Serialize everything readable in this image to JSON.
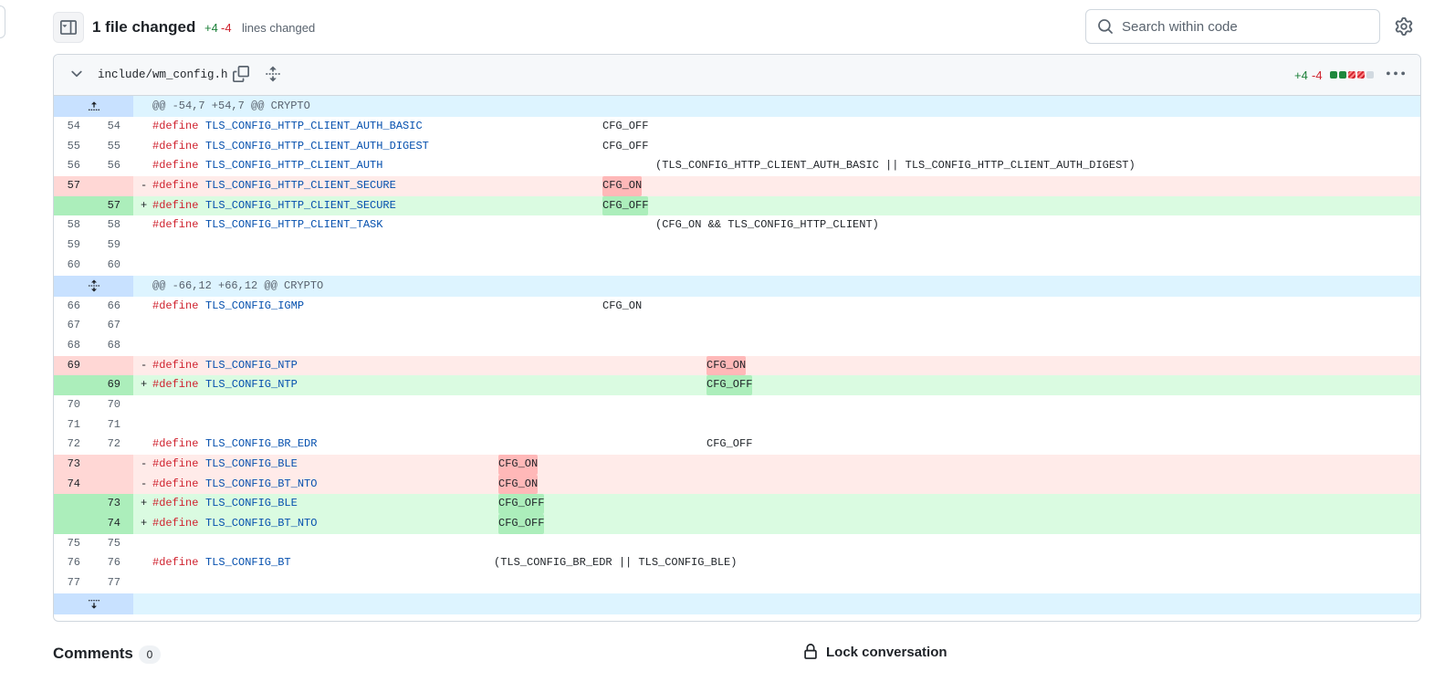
{
  "header": {
    "files_changed": "1 file changed",
    "additions": "+4",
    "deletions": "-4",
    "lines_changed_label": "lines changed",
    "search_placeholder": "Search within code"
  },
  "file": {
    "name": "include/wm_config.h",
    "additions": "+4",
    "deletions": "-4",
    "diffstat_blocks": [
      "added",
      "added",
      "deleted",
      "deleted",
      "neutral"
    ]
  },
  "colors": {
    "added": "#1f883d",
    "deleted": "#cf222e",
    "neutral": "#d1d9e0"
  },
  "diff": {
    "hunk1_header": "@@ -54,7 +54,7 @@ CRYPTO",
    "hunk2_header": "@@ -66,12 +66,12 @@ CRYPTO",
    "lines": [
      {
        "old": "54",
        "new": "54",
        "sign": "",
        "kw": "#define",
        "name": "TLS_CONFIG_HTTP_CLIENT_AUTH_BASIC",
        "value": "CFG_OFF"
      },
      {
        "old": "55",
        "new": "55",
        "sign": "",
        "kw": "#define",
        "name": "TLS_CONFIG_HTTP_CLIENT_AUTH_DIGEST",
        "value": "CFG_OFF"
      },
      {
        "old": "56",
        "new": "56",
        "sign": "",
        "kw": "#define",
        "name": "TLS_CONFIG_HTTP_CLIENT_AUTH",
        "value": "(TLS_CONFIG_HTTP_CLIENT_AUTH_BASIC || TLS_CONFIG_HTTP_CLIENT_AUTH_DIGEST)"
      },
      {
        "old": "57",
        "new": "",
        "sign": "-",
        "kw": "#define",
        "name": "TLS_CONFIG_HTTP_CLIENT_SECURE",
        "value": "CFG_ON"
      },
      {
        "old": "",
        "new": "57",
        "sign": "+",
        "kw": "#define",
        "name": "TLS_CONFIG_HTTP_CLIENT_SECURE",
        "value": "CFG_OFF"
      },
      {
        "old": "58",
        "new": "58",
        "sign": "",
        "kw": "#define",
        "name": "TLS_CONFIG_HTTP_CLIENT_TASK",
        "value": "(CFG_ON && TLS_CONFIG_HTTP_CLIENT)"
      },
      {
        "old": "59",
        "new": "59"
      },
      {
        "old": "60",
        "new": "60"
      },
      {
        "old": "66",
        "new": "66",
        "sign": "",
        "kw": "#define",
        "name": "TLS_CONFIG_IGMP",
        "value": "CFG_ON"
      },
      {
        "old": "67",
        "new": "67"
      },
      {
        "old": "68",
        "new": "68"
      },
      {
        "old": "69",
        "new": "",
        "sign": "-",
        "kw": "#define",
        "name": "TLS_CONFIG_NTP",
        "value": "CFG_ON"
      },
      {
        "old": "",
        "new": "69",
        "sign": "+",
        "kw": "#define",
        "name": "TLS_CONFIG_NTP",
        "value": "CFG_OFF"
      },
      {
        "old": "70",
        "new": "70"
      },
      {
        "old": "71",
        "new": "71"
      },
      {
        "old": "72",
        "new": "72",
        "sign": "",
        "kw": "#define",
        "name": "TLS_CONFIG_BR_EDR",
        "value": "CFG_OFF"
      },
      {
        "old": "73",
        "new": "",
        "sign": "-",
        "kw": "#define",
        "name": "TLS_CONFIG_BLE",
        "value": "CFG_ON"
      },
      {
        "old": "74",
        "new": "",
        "sign": "-",
        "kw": "#define",
        "name": "TLS_CONFIG_BT_NTO",
        "value": "CFG_ON"
      },
      {
        "old": "",
        "new": "73",
        "sign": "+",
        "kw": "#define",
        "name": "TLS_CONFIG_BLE",
        "value": "CFG_OFF"
      },
      {
        "old": "",
        "new": "74",
        "sign": "+",
        "kw": "#define",
        "name": "TLS_CONFIG_BT_NTO",
        "value": "CFG_OFF"
      },
      {
        "old": "75",
        "new": "75"
      },
      {
        "old": "76",
        "new": "76",
        "sign": "",
        "kw": "#define",
        "name": "TLS_CONFIG_BT",
        "value": "(TLS_CONFIG_BR_EDR || TLS_CONFIG_BLE)"
      },
      {
        "old": "77",
        "new": "77"
      }
    ]
  },
  "footer": {
    "comments_label": "Comments",
    "comments_count": "0",
    "lock_label": "Lock conversation"
  }
}
